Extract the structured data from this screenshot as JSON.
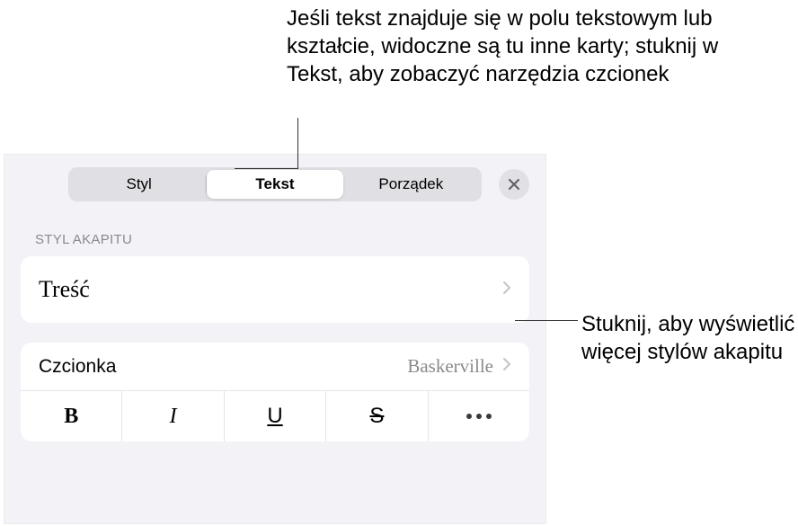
{
  "callouts": {
    "top": "Jeśli tekst znajduje się w polu tekstowym lub kształcie, widoczne są tu inne karty; stuknij w Tekst, aby zobaczyć narzędzia czcionek",
    "right": "Stuknij, aby wyświetlić więcej stylów akapitu"
  },
  "tabs": {
    "style": "Styl",
    "text": "Tekst",
    "arrange": "Porządek"
  },
  "sections": {
    "paragraphStyle": {
      "header": "STYL AKAPITU",
      "value": "Treść"
    },
    "font": {
      "label": "Czcionka",
      "value": "Baskerville"
    },
    "format": {
      "bold": "B",
      "italic": "I",
      "underline": "U",
      "strike": "S"
    }
  }
}
